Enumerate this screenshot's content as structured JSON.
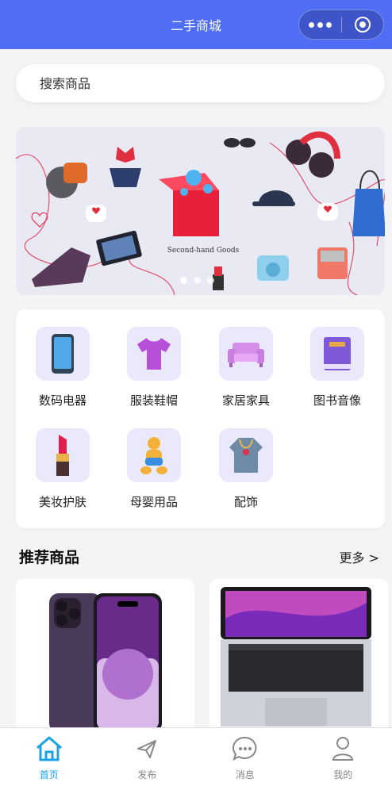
{
  "navbar": {
    "title": "二手商城"
  },
  "search": {
    "placeholder": "搜索商品"
  },
  "banner": {
    "text": "Second-hand Goods",
    "slides": 3,
    "active_slide": 1
  },
  "categories": [
    {
      "label": "数码电器",
      "icon": "phone-icon"
    },
    {
      "label": "服装鞋帽",
      "icon": "tshirt-icon"
    },
    {
      "label": "家居家具",
      "icon": "sofa-icon"
    },
    {
      "label": "图书音像",
      "icon": "book-icon"
    },
    {
      "label": "美妆护肤",
      "icon": "lipstick-icon"
    },
    {
      "label": "母婴用品",
      "icon": "baby-icon"
    },
    {
      "label": "配饰",
      "icon": "necklace-icon"
    }
  ],
  "recommend": {
    "title": "推荐商品",
    "more": "更多 >"
  },
  "tabbar": [
    {
      "label": "首页",
      "icon": "home-icon",
      "active": true
    },
    {
      "label": "发布",
      "icon": "send-icon",
      "active": false
    },
    {
      "label": "消息",
      "icon": "message-icon",
      "active": false
    },
    {
      "label": "我的",
      "icon": "user-icon",
      "active": false
    }
  ],
  "colors": {
    "primary": "#4f6df5",
    "tab_active": "#1aa3e8",
    "category_bg": "#e9e9fb"
  }
}
